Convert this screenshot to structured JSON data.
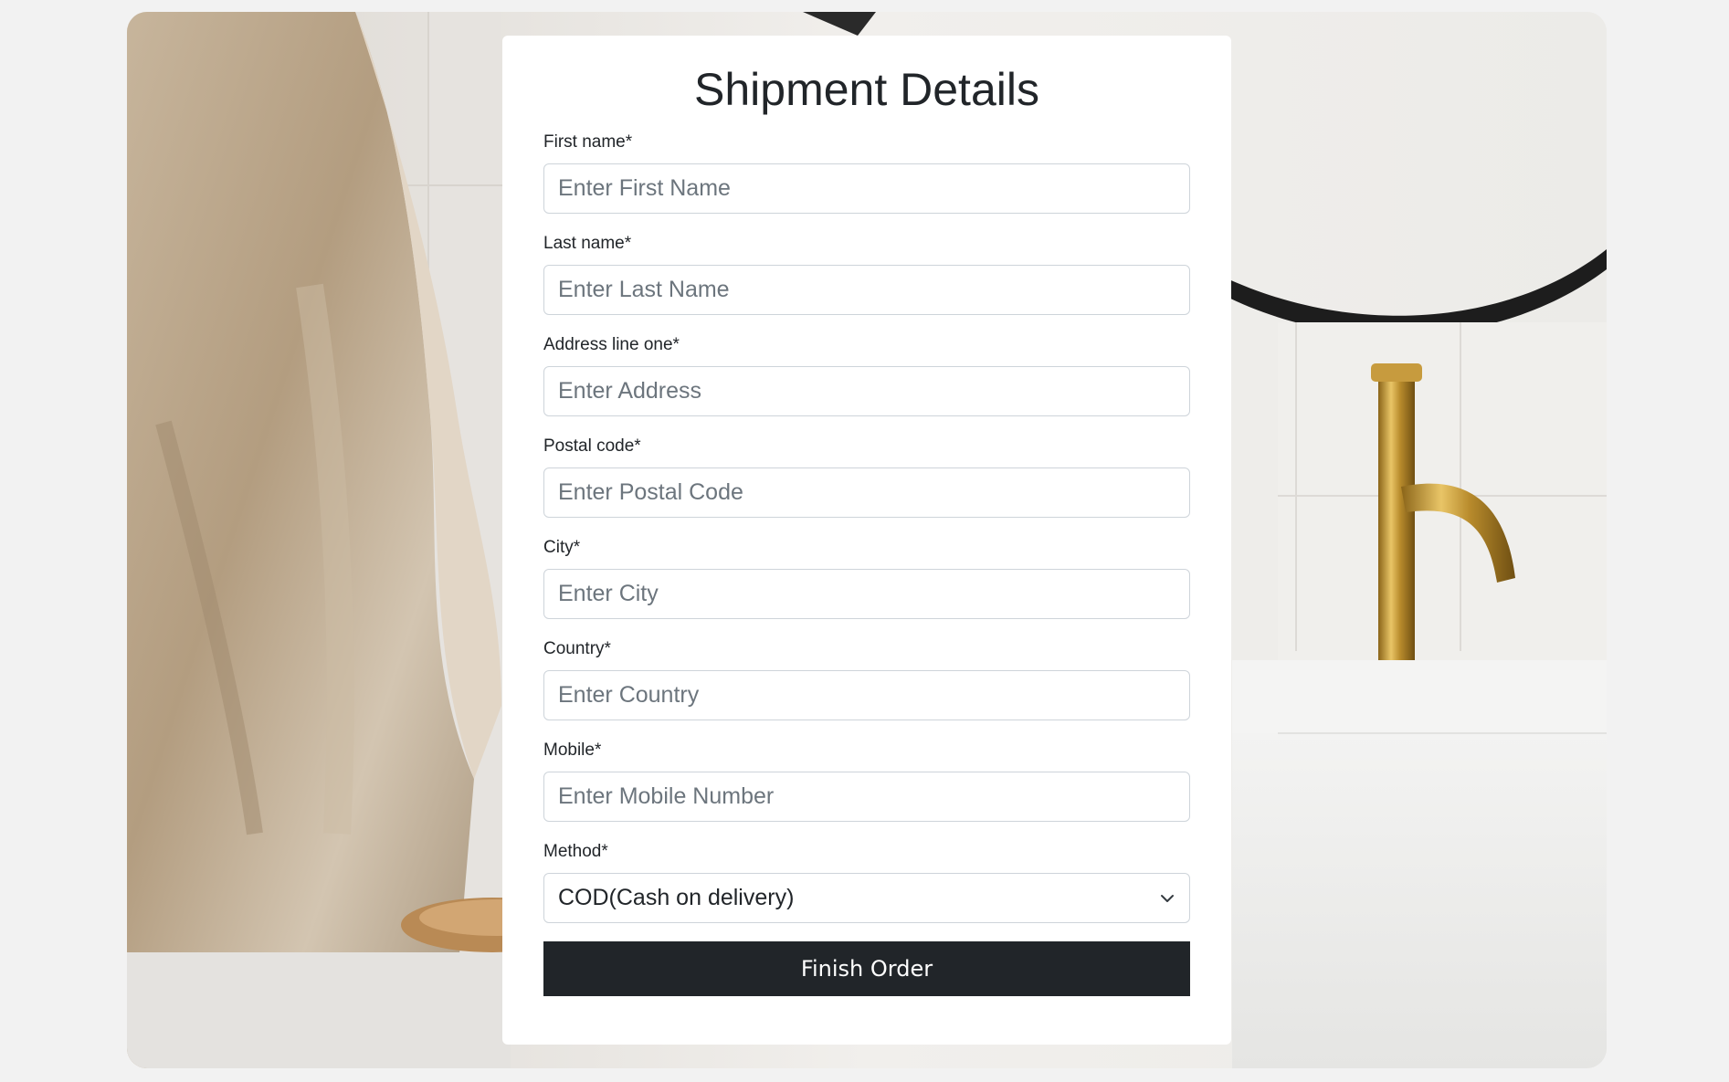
{
  "form": {
    "title": "Shipment Details",
    "fields": {
      "first_name": {
        "label": "First name*",
        "placeholder": "Enter First Name"
      },
      "last_name": {
        "label": "Last name*",
        "placeholder": "Enter Last Name"
      },
      "address": {
        "label": "Address line one*",
        "placeholder": "Enter Address"
      },
      "postal_code": {
        "label": "Postal code*",
        "placeholder": "Enter Postal Code"
      },
      "city": {
        "label": "City*",
        "placeholder": "Enter City"
      },
      "country": {
        "label": "Country*",
        "placeholder": "Enter Country"
      },
      "mobile": {
        "label": "Mobile*",
        "placeholder": "Enter Mobile Number"
      },
      "method": {
        "label": "Method*",
        "selected": "COD(Cash on delivery)"
      }
    },
    "submit_label": "Finish Order"
  },
  "icons": {
    "method_dropdown": "chevron-down-icon"
  },
  "colors": {
    "page_background": "#f2f2f2",
    "button_background": "#212529",
    "button_text": "#ffffff",
    "input_border": "#ced4da",
    "placeholder_text": "#6c757d"
  }
}
